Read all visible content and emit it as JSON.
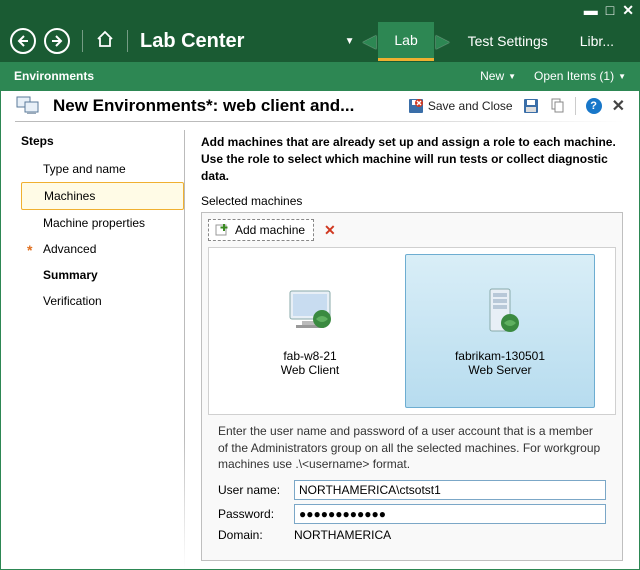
{
  "titlebar": {
    "minimize": "—",
    "maximize": "▭",
    "close": "✕"
  },
  "nav": {
    "title": "Lab Center",
    "tabs": [
      {
        "label": "Lab",
        "active": true
      },
      {
        "label": "Test Settings",
        "active": false
      },
      {
        "label": "Libr...",
        "active": false
      }
    ]
  },
  "subnav": {
    "left": "Environments",
    "new": "New",
    "open_items": "Open Items (1)"
  },
  "dialog": {
    "title": "New Environments*: web client and...",
    "save_close": "Save and Close"
  },
  "steps": {
    "title": "Steps",
    "items": [
      {
        "label": "Type and name",
        "active": false,
        "bold": false,
        "required": false
      },
      {
        "label": "Machines",
        "active": true,
        "bold": false,
        "required": false
      },
      {
        "label": "Machine properties",
        "active": false,
        "bold": false,
        "required": false
      },
      {
        "label": "Advanced",
        "active": false,
        "bold": false,
        "required": true
      },
      {
        "label": "Summary",
        "active": false,
        "bold": true,
        "required": false
      },
      {
        "label": "Verification",
        "active": false,
        "bold": false,
        "required": false
      }
    ]
  },
  "main": {
    "instructions": "Add machines that are already set up and assign a role to each machine. Use the role to select which machine will run tests or collect diagnostic data.",
    "selected_label": "Selected machines",
    "add_machine": "Add machine",
    "machines": [
      {
        "name": "fab-w8-21",
        "role": "Web Client",
        "selected": false,
        "type": "client"
      },
      {
        "name": "fabrikam-130501",
        "role": "Web Server",
        "selected": true,
        "type": "server"
      }
    ],
    "creds_help": "Enter the user name and password of a user account that is a member of the Administrators group on all the selected machines. For workgroup machines use .\\<username> format.",
    "username_label": "User name:",
    "username_value": "NORTHAMERICA\\ctsotst1",
    "password_label": "Password:",
    "password_value": "●●●●●●●●●●●●",
    "domain_label": "Domain:",
    "domain_value": "NORTHAMERICA"
  }
}
